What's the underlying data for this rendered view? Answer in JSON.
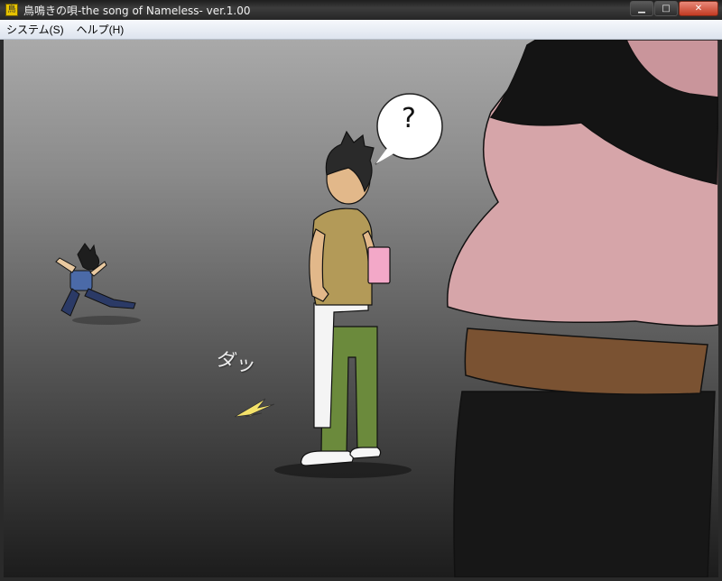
{
  "window": {
    "title": "鳥鳴きの唄-the song of Nameless- ver.1.00",
    "icon_name": "app-icon",
    "buttons": [
      "minimize-icon",
      "maximize-icon",
      "close-icon"
    ]
  },
  "menubar": {
    "items": [
      {
        "label": "システム(S)"
      },
      {
        "label": "ヘルプ(H)"
      }
    ]
  },
  "scene": {
    "sound_effect": "ダッ",
    "speech_bubble": "?"
  }
}
